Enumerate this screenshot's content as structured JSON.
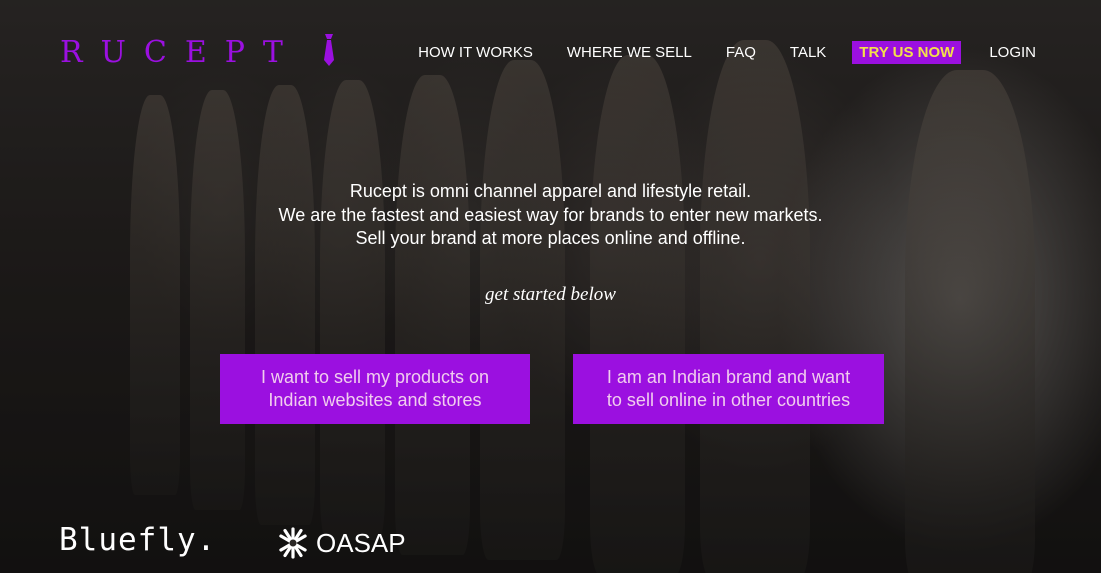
{
  "header": {
    "logo_text": "RUCEPT",
    "logo_color": "#9b10e0",
    "nav": [
      {
        "label": "HOW IT WORKS"
      },
      {
        "label": "WHERE WE SELL"
      },
      {
        "label": "FAQ"
      },
      {
        "label": "TALK"
      },
      {
        "label": "TRY US NOW"
      },
      {
        "label": "LOGIN"
      }
    ],
    "cta_bg": "#9b10e0",
    "cta_text_color": "#f3e04b"
  },
  "intro": {
    "lines": [
      "Rucept is omni channel apparel and lifestyle retail.",
      "We are the fastest and easiest way for brands to enter new markets.",
      "Sell your brand at more places online and offline."
    ]
  },
  "tagline": "get started below",
  "cta": {
    "sell_india": {
      "line1": "I want to sell my products on",
      "line2": "Indian websites and stores"
    },
    "sell_abroad": {
      "line1": "I am an Indian brand and want",
      "line2": "to sell online in other countries"
    }
  },
  "partners": {
    "bluefly": "Bluefly.",
    "oasap": "OASAP",
    "oasap_icon": "snowflake-icon"
  }
}
